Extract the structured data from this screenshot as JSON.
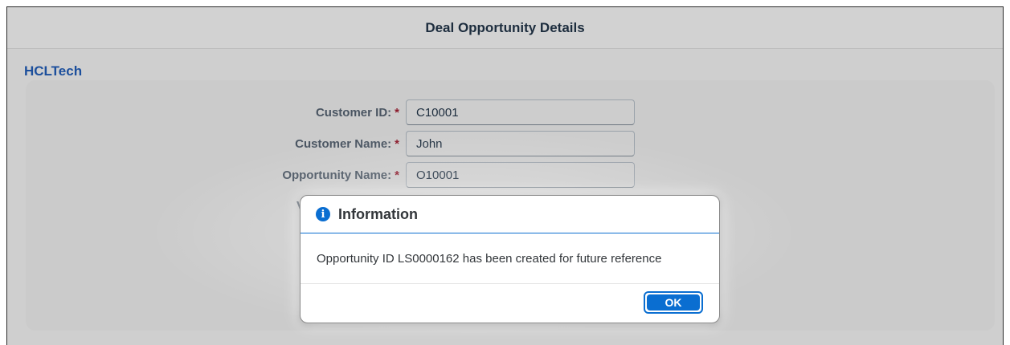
{
  "page": {
    "title": "Deal Opportunity Details",
    "brand": "HCLTech"
  },
  "form": {
    "required_mark": "*",
    "fields": [
      {
        "label": "Customer ID:",
        "value": "C10001"
      },
      {
        "label": "Customer Name:",
        "value": "John"
      },
      {
        "label": "Opportunity Name:",
        "value": "O10001"
      }
    ],
    "hidden_label_fragment": "V"
  },
  "dialog": {
    "icon": "info-icon",
    "icon_glyph": "i",
    "title": "Information",
    "message": "Opportunity ID LS0000162 has been created for future reference",
    "ok_label": "OK"
  },
  "colors": {
    "accent": "#0a6ed1",
    "brand": "#1c4f9c",
    "required": "#8b1a2b"
  }
}
